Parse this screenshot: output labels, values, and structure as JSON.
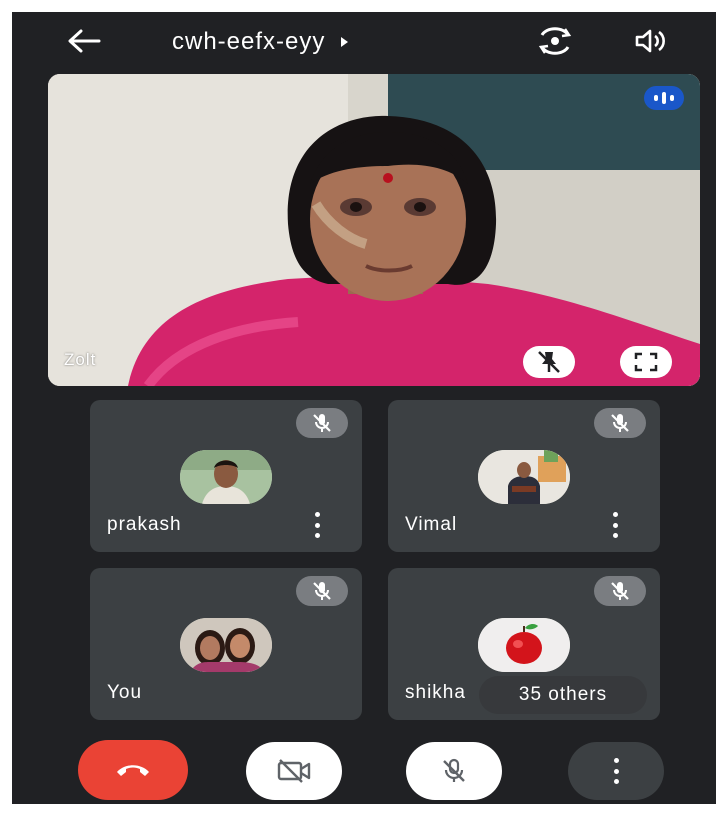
{
  "header": {
    "meeting_code": "cwh-eefx-eyy",
    "back_icon": "arrow-left-icon",
    "switch_camera_icon": "camera-switch-icon",
    "speaker_icon": "speaker-icon"
  },
  "main_video": {
    "participant_name": "Zolt",
    "speaking_icon": "speaking-indicator-icon",
    "unpin_icon": "unpin-icon",
    "fullscreen_icon": "fullscreen-icon"
  },
  "participants": [
    {
      "name": "prakash",
      "muted": true,
      "has_menu": true
    },
    {
      "name": "Vimal",
      "muted": true,
      "has_menu": true
    },
    {
      "name": "You",
      "muted": true,
      "has_menu": false
    },
    {
      "name": "shikha",
      "muted": true,
      "has_menu": false
    }
  ],
  "others_label": "35 others",
  "controls": {
    "end_call_icon": "phone-hangup-icon",
    "camera_icon": "camera-off-icon",
    "mic_icon": "mic-off-icon",
    "more_icon": "more-vert-icon"
  },
  "colors": {
    "background": "#202124",
    "tile": "#3c4043",
    "end_call": "#ea4335",
    "speaking_badge": "#1a57c9"
  }
}
